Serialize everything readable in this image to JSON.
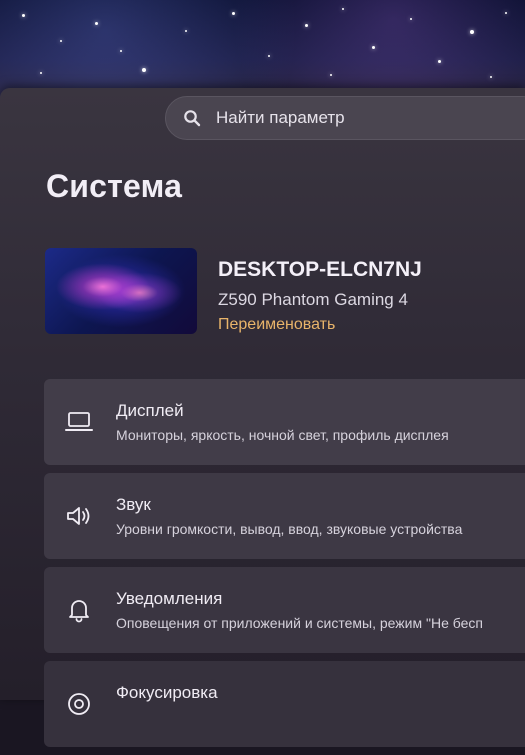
{
  "search": {
    "placeholder": "Найти параметр",
    "icon": "search-icon"
  },
  "page": {
    "title": "Система"
  },
  "device": {
    "name": "DESKTOP-ELCN7NJ",
    "model": "Z590 Phantom Gaming 4",
    "rename_label": "Переименовать"
  },
  "settings": [
    {
      "icon": "laptop-icon",
      "title": "Дисплей",
      "description": "Мониторы, яркость, ночной свет, профиль дисплея"
    },
    {
      "icon": "speaker-icon",
      "title": "Звук",
      "description": "Уровни громкости, вывод, ввод, звуковые устройства"
    },
    {
      "icon": "bell-icon",
      "title": "Уведомления",
      "description": "Оповещения от приложений и системы, режим \"Не бесп"
    },
    {
      "icon": "focus-icon",
      "title": "Фокусировка",
      "description": ""
    }
  ],
  "colors": {
    "accent_link": "#e8b46a"
  }
}
